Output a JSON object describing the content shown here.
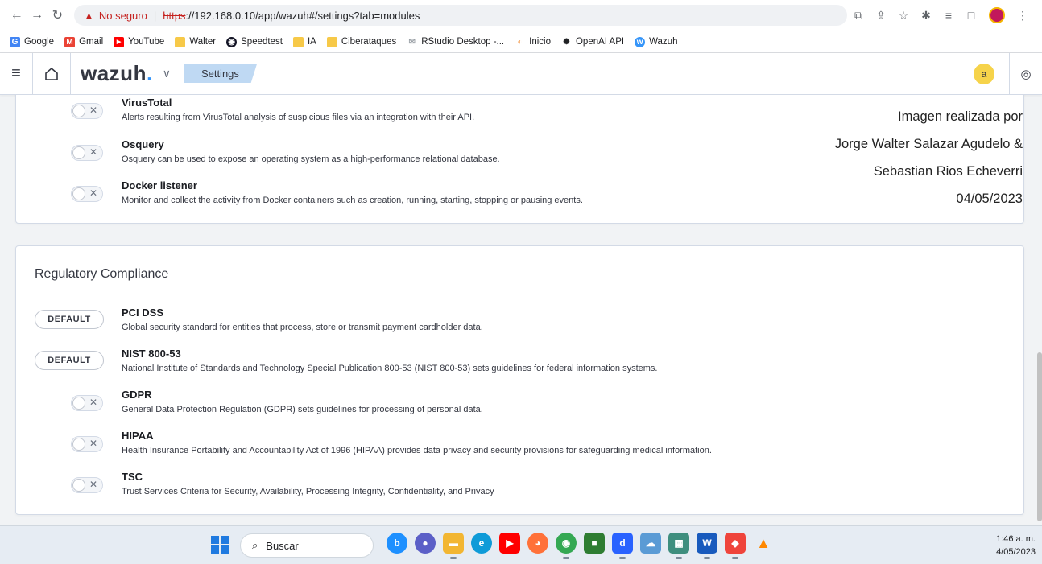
{
  "browser": {
    "not_secure": "No seguro",
    "url_protocol": "https",
    "url_rest": "://192.168.0.10/app/wazuh#/settings?tab=modules",
    "bookmarks": [
      {
        "label": "Google",
        "color": "#4285f4",
        "glyph": "G"
      },
      {
        "label": "Gmail",
        "color": "#ea4335",
        "glyph": "M"
      },
      {
        "label": "YouTube",
        "color": "#ff0000",
        "glyph": "▶"
      },
      {
        "label": "Walter",
        "color": "#f7c948",
        "glyph": ""
      },
      {
        "label": "Speedtest",
        "color": "#141526",
        "glyph": "◉"
      },
      {
        "label": "IA",
        "color": "#f7c948",
        "glyph": ""
      },
      {
        "label": "Ciberataques",
        "color": "#f7c948",
        "glyph": ""
      },
      {
        "label": "RStudio Desktop -...",
        "color": "#9aa0a6",
        "glyph": "✉"
      },
      {
        "label": "Inicio",
        "color": "#f28b30",
        "glyph": "◐"
      },
      {
        "label": "OpenAI API",
        "color": "#202124",
        "glyph": "✺"
      },
      {
        "label": "Wazuh",
        "color": "#3595f9",
        "glyph": "w"
      }
    ]
  },
  "header": {
    "logo": "wazuh",
    "logo_dot": ".",
    "breadcrumb": "Settings",
    "avatar_initial": "a"
  },
  "modules": [
    {
      "title": "VirusTotal",
      "description": "Alerts resulting from VirusTotal analysis of suspicious files via an integration with their API."
    },
    {
      "title": "Osquery",
      "description": "Osquery can be used to expose an operating system as a high-performance relational database."
    },
    {
      "title": "Docker listener",
      "description": "Monitor and collect the activity from Docker containers such as creation, running, starting, stopping or pausing events."
    }
  ],
  "watermark": [
    "Imagen realizada por",
    "Jorge Walter Salazar Agudelo &",
    "Sebastian Rios Echeverri",
    "04/05/2023"
  ],
  "compliance": {
    "title": "Regulatory Compliance",
    "default_label": "DEFAULT",
    "items": [
      {
        "title": "PCI DSS",
        "description": "Global security standard for entities that process, store or transmit payment cardholder data."
      },
      {
        "title": "NIST 800-53",
        "description": "National Institute of Standards and Technology Special Publication 800-53 (NIST 800-53) sets guidelines for federal information systems."
      },
      {
        "title": "GDPR",
        "description": "General Data Protection Regulation (GDPR) sets guidelines for processing of personal data."
      },
      {
        "title": "HIPAA",
        "description": "Health Insurance Portability and Accountability Act of 1996 (HIPAA) provides data privacy and security provisions for safeguarding medical information."
      },
      {
        "title": "TSC",
        "description": "Trust Services Criteria for Security, Availability, Processing Integrity, Confidentiality, and Privacy"
      }
    ]
  },
  "taskbar": {
    "search_placeholder": "Buscar",
    "time": "1:46 a. m.",
    "date": "4/05/2023",
    "apps": [
      {
        "name": "bing-icon",
        "color": "#1e90ff",
        "glyph": "b"
      },
      {
        "name": "teams-chat-icon",
        "color": "#5b5fc7",
        "glyph": "●"
      },
      {
        "name": "file-explorer-icon",
        "color": "#f2b632",
        "glyph": "▬"
      },
      {
        "name": "edge-icon",
        "color": "#0e9bd8",
        "glyph": "e"
      },
      {
        "name": "youtube-icon",
        "color": "#ff0000",
        "glyph": "▶"
      },
      {
        "name": "firefox-icon",
        "color": "#ff7139",
        "glyph": "◕"
      },
      {
        "name": "chrome-icon",
        "color": "#34a853",
        "glyph": "◉"
      },
      {
        "name": "sticky-notes-icon",
        "color": "#2e7d32",
        "glyph": "■"
      },
      {
        "name": "blue-app-icon",
        "color": "#2962ff",
        "glyph": "d"
      },
      {
        "name": "onedrive-icon",
        "color": "#5a9bd5",
        "glyph": "☁"
      },
      {
        "name": "photos-icon",
        "color": "#3e8e7e",
        "glyph": "▦"
      },
      {
        "name": "word-icon",
        "color": "#185abd",
        "glyph": "W"
      },
      {
        "name": "anydesk-icon",
        "color": "#ef443b",
        "glyph": "◆"
      },
      {
        "name": "vlc-icon",
        "color": "#ff8800",
        "glyph": "▲"
      }
    ]
  }
}
